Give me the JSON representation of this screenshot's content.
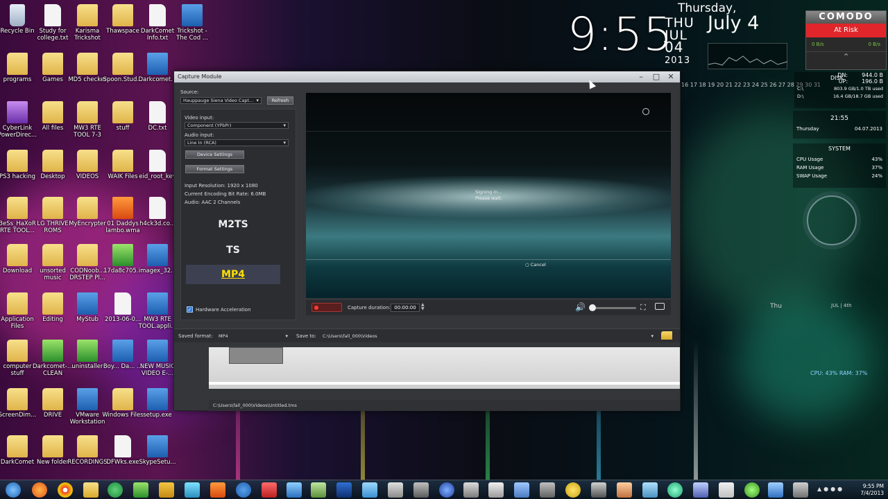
{
  "desktop_icons": [
    {
      "label": "Recycle Bin",
      "type": "bin"
    },
    {
      "label": "Study for college.txt",
      "type": "file"
    },
    {
      "label": "Karisma Trickshot",
      "type": "folder"
    },
    {
      "label": "Thawspace",
      "type": "folder"
    },
    {
      "label": "DarkComet Info.txt",
      "type": "file"
    },
    {
      "label": "Trickshot - The Cod ...",
      "type": "exe"
    },
    {
      "label": "programs",
      "type": "folder"
    },
    {
      "label": "Games",
      "type": "folder"
    },
    {
      "label": "MD5 checker",
      "type": "folder"
    },
    {
      "label": "Spoon.Stud...",
      "type": "folder"
    },
    {
      "label": "Darkcomet...",
      "type": "exe"
    },
    {
      "label": "CyberLink PowerDirec...",
      "type": "purple"
    },
    {
      "label": "All files",
      "type": "folder"
    },
    {
      "label": "MW3 RTE TOOL 7-3",
      "type": "folder"
    },
    {
      "label": "stuff",
      "type": "folder"
    },
    {
      "label": "DC.txt",
      "type": "file"
    },
    {
      "label": "PS3 hacking",
      "type": "folder"
    },
    {
      "label": "Desktop",
      "type": "folder"
    },
    {
      "label": "VIDEOS",
      "type": "folder"
    },
    {
      "label": "WAIK Files",
      "type": "folder"
    },
    {
      "label": "eid_root_key",
      "type": "file"
    },
    {
      "label": "BeSs_HaXoR RTE TOOL...",
      "type": "folder"
    },
    {
      "label": "LG THRIVE ROMS",
      "type": "folder"
    },
    {
      "label": "MyEncrypter",
      "type": "folder"
    },
    {
      "label": "01 Daddys lambo.wma",
      "type": "red"
    },
    {
      "label": "h4ck3d.co...",
      "type": "file"
    },
    {
      "label": "Download",
      "type": "folder"
    },
    {
      "label": "unsorted music",
      "type": "folder"
    },
    {
      "label": "CODNoob... DRSTEP Pl...",
      "type": "folder"
    },
    {
      "label": "17da8c705...",
      "type": "green"
    },
    {
      "label": "imagex_32...",
      "type": "exe"
    },
    {
      "label": "Application Files",
      "type": "folder"
    },
    {
      "label": "Editing",
      "type": "folder"
    },
    {
      "label": "MyStub",
      "type": "exe"
    },
    {
      "label": "2013-06-0...",
      "type": "file"
    },
    {
      "label": "MW3 RTE TOOL.appli...",
      "type": "exe"
    },
    {
      "label": "computer stuff",
      "type": "folder"
    },
    {
      "label": "Darkcomet-... CLEAN",
      "type": "green"
    },
    {
      "label": "uninstaller",
      "type": "green"
    },
    {
      "label": "Boy... Da... ...",
      "type": "exe"
    },
    {
      "label": "NEW MUSIC VIDEO E-...",
      "type": "exe"
    },
    {
      "label": "ScreenDim...",
      "type": "folder"
    },
    {
      "label": "DRIVE",
      "type": "folder"
    },
    {
      "label": "VMware Workstation",
      "type": "exe"
    },
    {
      "label": "Windows Files",
      "type": "folder"
    },
    {
      "label": "setup.exe",
      "type": "exe"
    },
    {
      "label": "DarkComet",
      "type": "folder"
    },
    {
      "label": "New folder",
      "type": "folder"
    },
    {
      "label": "RECORDINGS",
      "type": "folder"
    },
    {
      "label": "DFWks.exe",
      "type": "file"
    },
    {
      "label": "SkypeSetu...",
      "type": "exe"
    }
  ],
  "widgets": {
    "clock_time": "9:55",
    "dow_short": "THU",
    "month_short": "JUL",
    "day_num": "04",
    "year": "2013",
    "day_name": "Thursday,",
    "date_long": "July 4",
    "calendar_row": "16 17 18 19 20 21 22 23 24 25 26 27 28 29 30 31",
    "comodo_brand": "COMODO",
    "comodo_status": "At Risk",
    "comodo_rate_left": "0 B/s",
    "comodo_rate_right": "0 B/s",
    "disk_dn_label": "DN:",
    "disk_dn_value": "944.0 B",
    "disk_up_label": "UP:",
    "disk_up_value": "196.0 B",
    "disk_title": "DISK",
    "drive_c_label": "C:\\",
    "drive_c_value": "803.9 GB/1.0 TB used",
    "drive_d_label": "D:\\",
    "drive_d_value": "16.4 GB/18.7 GB used",
    "time_small": "21:55",
    "time_day": "Thursday",
    "time_date": "04.07.2013",
    "system_title": "SYSTEM",
    "cpu_label": "CPU Usage",
    "cpu_value": "43%",
    "ram_label": "RAM Usage",
    "ram_value": "37%",
    "swap_label": "SWAP Usage",
    "swap_value": "24%",
    "cpu_ram_readout": "CPU: 43%    RAM: 37%",
    "thu_label": "Thu",
    "jul4_label": "JUL | 4th"
  },
  "window": {
    "title": "Capture Module",
    "minimize": "–",
    "maximize": "□",
    "close": "✕",
    "source_label": "Source:",
    "source_value": "Hauppauge Siena Video Capt...",
    "refresh_label": "Refresh",
    "video_input_label": "Video input:",
    "video_input_value": "Component (YPbPr)",
    "audio_input_label": "Audio input:",
    "audio_input_value": "Line In (RCA)",
    "device_settings_label": "Device Settings",
    "format_settings_label": "Format Settings",
    "input_resolution": "Input Resolution: 1920 x 1080",
    "encoding_bitrate": "Current Encoding Bit Rate: 6.0MB",
    "audio_info": "Audio: AAC 2 Channels",
    "formats": [
      {
        "label": "M2TS",
        "selected": false
      },
      {
        "label": "TS",
        "selected": false
      },
      {
        "label": "MP4",
        "selected": true
      }
    ],
    "hw_accel_label": "Hardware Acceleration",
    "hw_accel_checked": true,
    "signing_in_line1": "Signing in...",
    "signing_in_line2": "Please wait.",
    "cancel_label": "Cancel",
    "capture_duration_label": "Capture duration:",
    "capture_duration_value": "00:00:00",
    "volume_level": 0.0,
    "saved_format_label": "Saved format:",
    "saved_format_value": "MP4",
    "save_to_label": "Save to:",
    "save_to_value": "C:\\Users\\fall_000\\Videos",
    "status_path": "C:\\Users\\fall_000\\Videos\\Untitled.tms"
  },
  "taskbar": {
    "tray_time": "9:55 PM",
    "tray_date": "7/4/2013"
  },
  "colors": {
    "accent_selected": "#ffe000",
    "comodo_risk": "#e0262a",
    "record": "#ff3b30"
  }
}
